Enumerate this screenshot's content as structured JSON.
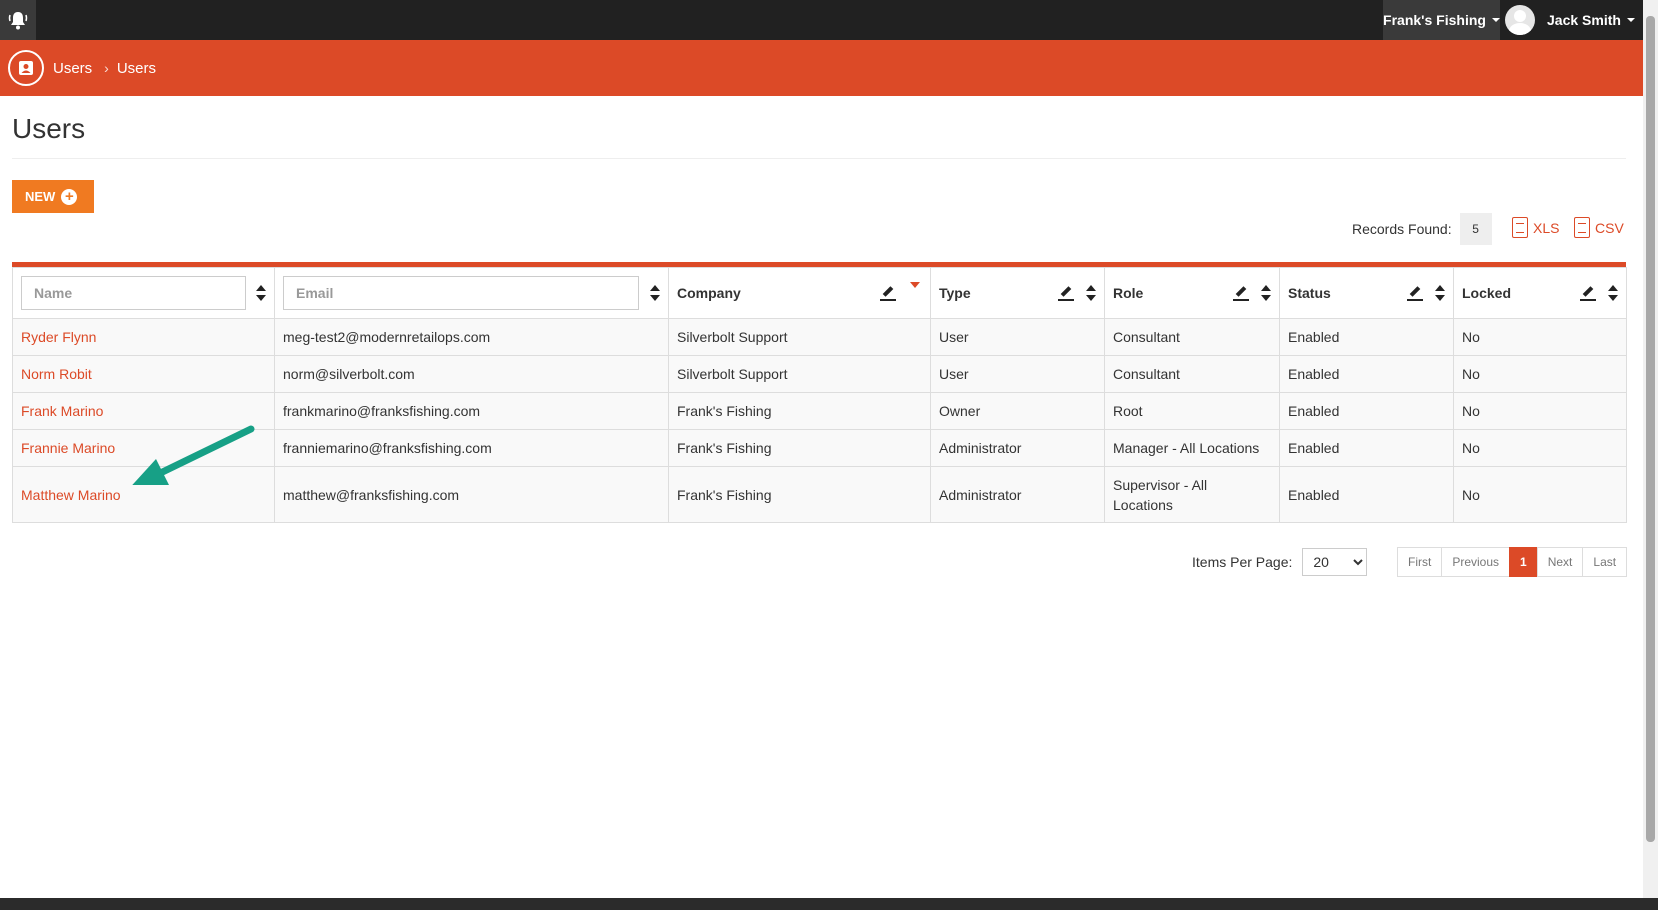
{
  "header": {
    "company": "Frank's Fishing",
    "user_name": "Jack Smith"
  },
  "breadcrumb": [
    "Users",
    "Users"
  ],
  "page": {
    "title": "Users",
    "new_button": "NEW"
  },
  "records": {
    "label": "Records Found:",
    "count": "5"
  },
  "exports": {
    "xls": "XLS",
    "csv": "CSV"
  },
  "table": {
    "filters": {
      "name_placeholder": "Name",
      "email_placeholder": "Email"
    },
    "columns": [
      "Company",
      "Type",
      "Role",
      "Status",
      "Locked"
    ],
    "rows": [
      {
        "name": "Ryder Flynn",
        "email": "meg-test2@modernretailops.com",
        "company": "Silverbolt Support",
        "type": "User",
        "role": "Consultant",
        "status": "Enabled",
        "locked": "No"
      },
      {
        "name": "Norm Robit",
        "email": "norm@silverbolt.com",
        "company": "Silverbolt Support",
        "type": "User",
        "role": "Consultant",
        "status": "Enabled",
        "locked": "No"
      },
      {
        "name": "Frank Marino",
        "email": "frankmarino@franksfishing.com",
        "company": "Frank's Fishing",
        "type": "Owner",
        "role": "Root",
        "status": "Enabled",
        "locked": "No"
      },
      {
        "name": "Frannie Marino",
        "email": "franniemarino@franksfishing.com",
        "company": "Frank's Fishing",
        "type": "Administrator",
        "role": "Manager - All Locations",
        "status": "Enabled",
        "locked": "No"
      },
      {
        "name": "Matthew Marino",
        "email": "matthew@franksfishing.com",
        "company": "Frank's Fishing",
        "type": "Administrator",
        "role": "Supervisor - All Locations",
        "status": "Enabled",
        "locked": "No"
      }
    ]
  },
  "pagination": {
    "items_per_page_label": "Items Per Page:",
    "items_per_page": "20",
    "first": "First",
    "previous": "Previous",
    "current": "1",
    "next": "Next",
    "last": "Last"
  },
  "colors": {
    "accent": "#dc4a27",
    "button": "#f07a21",
    "annotation_arrow": "#17a086"
  },
  "icons": [
    "bell-icon",
    "user-badge-icon",
    "chevron-right-icon",
    "plus-circle-icon",
    "xls-file-icon",
    "csv-file-icon",
    "pencil-icon",
    "sort-icon",
    "annotation-arrow-icon"
  ]
}
